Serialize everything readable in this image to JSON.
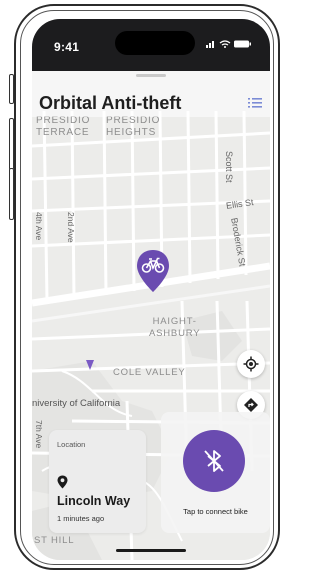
{
  "status_bar": {
    "time": "9:41",
    "icons": "•ıl ᯤ ▬"
  },
  "app": {
    "title": "Orbital Anti-theft",
    "menu_icon": "list-icon"
  },
  "map": {
    "labels": {
      "presidio_terrace": "PRESIDIO\nTERRACE",
      "presidio_heights": "PRESIDIO\nHEIGHTS",
      "scott_st": "Scott St",
      "ellis_st": "Ellis St",
      "broderick_st": "Broderick St",
      "second_ave": "2nd Ave",
      "fourth_ave": "4th Ave",
      "haight_ashbury": "HAIGHT-\nASHBURY",
      "cole_valley": "COLE VALLEY",
      "university": "niversity of California",
      "seventh_ave": "7th Ave",
      "st_hill": "ST HILL"
    },
    "accent_color": "#6a4bb0"
  },
  "location_card": {
    "caption": "Location",
    "name": "Lincoln Way",
    "time_ago": "1 minutes ago"
  },
  "connect_card": {
    "label": "Tap to connect bike",
    "icon": "bluetooth-disabled-icon"
  }
}
